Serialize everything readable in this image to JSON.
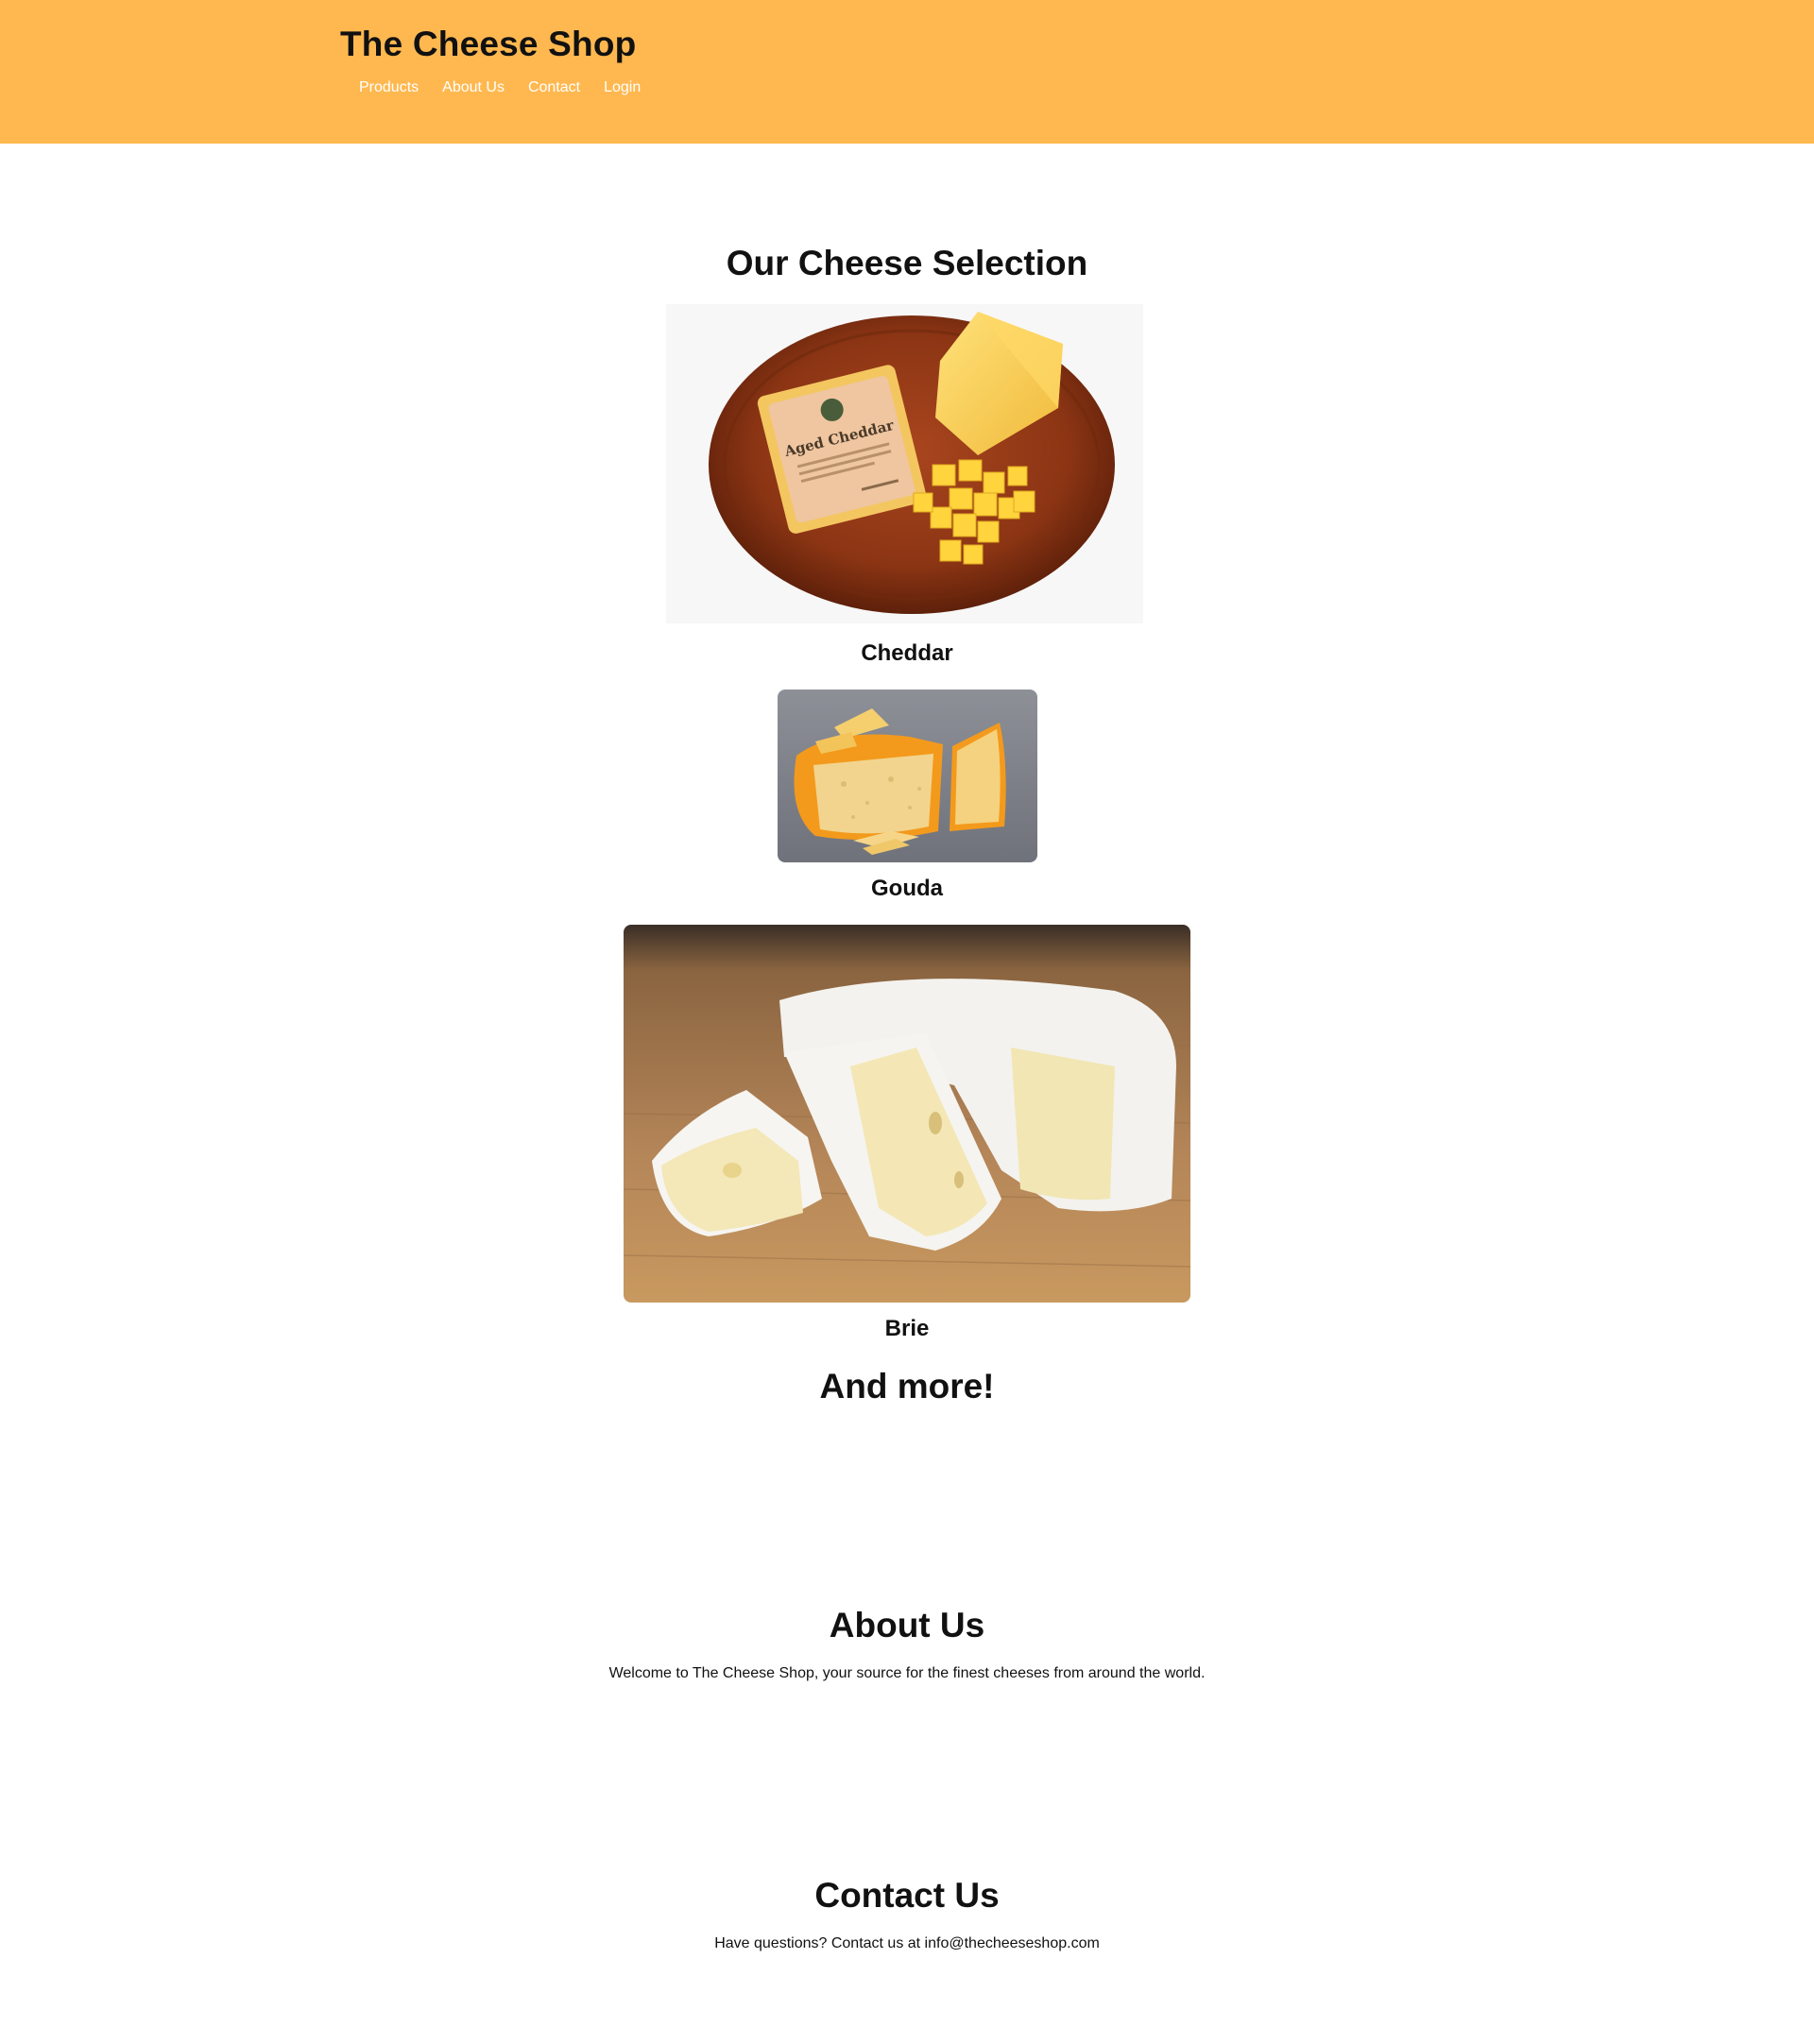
{
  "header": {
    "title": "The Cheese Shop",
    "nav": [
      "Products",
      "About Us",
      "Contact",
      "Login"
    ]
  },
  "products": {
    "heading": "Our Cheese Selection",
    "items": [
      {
        "name": "Cheddar",
        "package_label": "Aged Cheddar"
      },
      {
        "name": "Gouda"
      },
      {
        "name": "Brie"
      }
    ],
    "more": "And more!"
  },
  "about": {
    "heading": "About Us",
    "text": "Welcome to The Cheese Shop, your source for the finest cheeses from around the world."
  },
  "contact": {
    "heading": "Contact Us",
    "text": "Have questions? Contact us at info@thecheeseshop.com"
  },
  "colors": {
    "header_bg": "#ffb84f",
    "nav_text": "#ffffff",
    "body_text": "#111111"
  }
}
